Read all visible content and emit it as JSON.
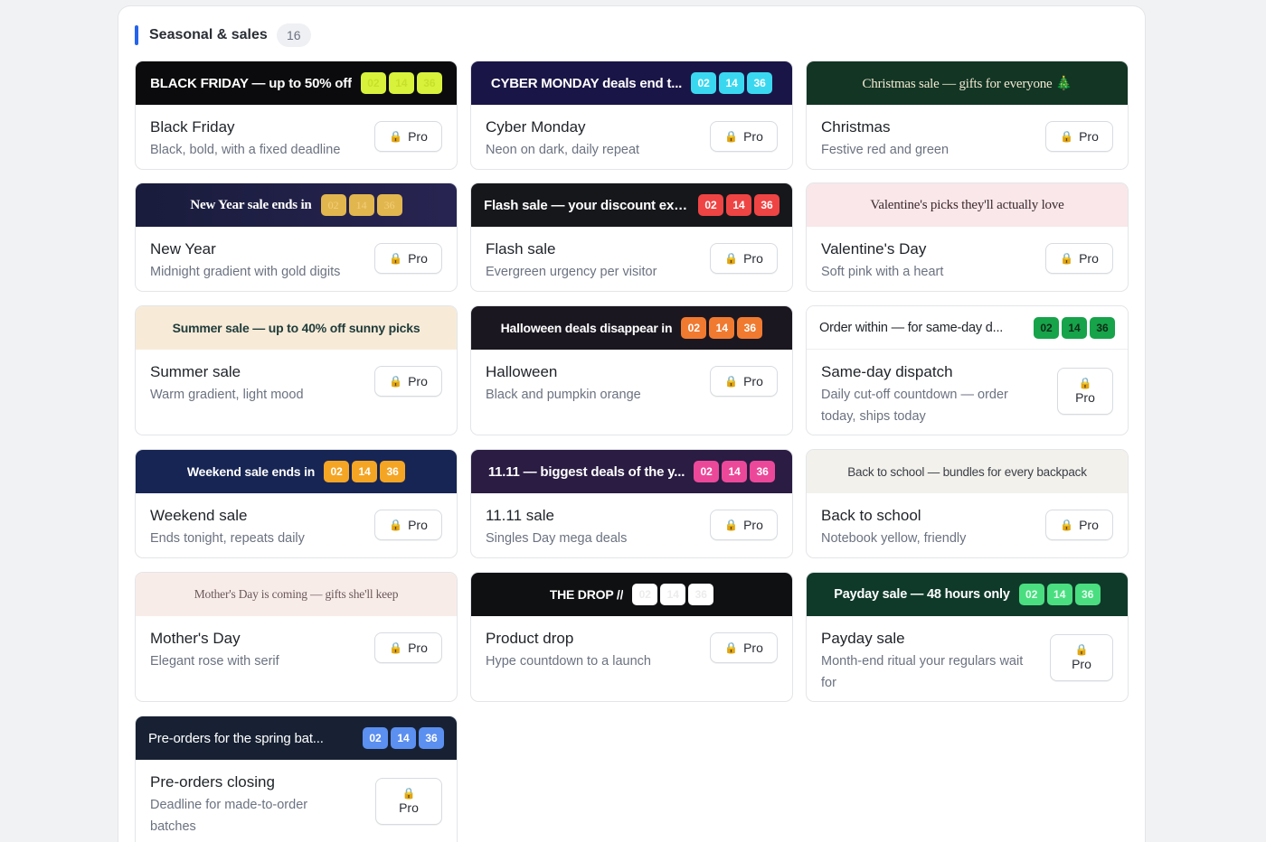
{
  "section": {
    "title": "Seasonal & sales",
    "count": "16"
  },
  "pro_label": "Pro",
  "icons": {
    "lock": "lock-icon"
  },
  "cards": [
    {
      "banner": "BLACK FRIDAY — up to 50% off",
      "title": "Black Friday",
      "desc": "Black, bold, with a fixed deadline",
      "digits": [
        "02",
        "14",
        "36"
      ]
    },
    {
      "banner": "CYBER MONDAY deals end t...",
      "title": "Cyber Monday",
      "desc": "Neon on dark, daily repeat",
      "digits": [
        "02",
        "14",
        "36"
      ]
    },
    {
      "banner": "Christmas sale — gifts for everyone 🎄",
      "title": "Christmas",
      "desc": "Festive red and green",
      "digits": []
    },
    {
      "banner": "New Year sale ends in",
      "title": "New Year",
      "desc": "Midnight gradient with gold digits",
      "digits": [
        "02",
        "14",
        "36"
      ]
    },
    {
      "banner": "Flash sale — your discount exp...",
      "title": "Flash sale",
      "desc": "Evergreen urgency per visitor",
      "digits": [
        "02",
        "14",
        "36"
      ]
    },
    {
      "banner": "Valentine's picks they'll actually love",
      "title": "Valentine's Day",
      "desc": "Soft pink with a heart",
      "digits": []
    },
    {
      "banner": "Summer sale — up to 40% off sunny picks",
      "title": "Summer sale",
      "desc": "Warm gradient, light mood",
      "digits": []
    },
    {
      "banner": "Halloween deals disappear in",
      "title": "Halloween",
      "desc": "Black and pumpkin orange",
      "digits": [
        "02",
        "14",
        "36"
      ]
    },
    {
      "banner": "Order within — for same-day d...",
      "title": "Same-day dispatch",
      "desc": "Daily cut-off countdown — order today, ships today",
      "digits": [
        "02",
        "14",
        "36"
      ]
    },
    {
      "banner": "Weekend sale ends in",
      "title": "Weekend sale",
      "desc": "Ends tonight, repeats daily",
      "digits": [
        "02",
        "14",
        "36"
      ]
    },
    {
      "banner": "11.11 — biggest deals of the y...",
      "title": "11.11 sale",
      "desc": "Singles Day mega deals",
      "digits": [
        "02",
        "14",
        "36"
      ]
    },
    {
      "banner": "Back to school — bundles for every backpack",
      "title": "Back to school",
      "desc": "Notebook yellow, friendly",
      "digits": []
    },
    {
      "banner": "Mother's Day is coming — gifts she'll keep",
      "title": "Mother's Day",
      "desc": "Elegant rose with serif",
      "digits": []
    },
    {
      "banner": "THE DROP //",
      "title": "Product drop",
      "desc": "Hype countdown to a launch",
      "digits": [
        "02",
        "14",
        "36"
      ]
    },
    {
      "banner": "Payday sale — 48 hours only",
      "title": "Payday sale",
      "desc": "Month-end ritual your regulars wait for",
      "digits": [
        "02",
        "14",
        "36"
      ]
    },
    {
      "banner": "Pre-orders for the spring bat...",
      "title": "Pre-orders closing",
      "desc": "Deadline for made-to-order batches",
      "digits": [
        "02",
        "14",
        "36"
      ]
    }
  ],
  "colors": {
    "accent": "#2563eb",
    "black_friday_bg": "#0b0b0d",
    "black_friday_digit": "#d8f23c",
    "cyber_bg": "#1a1547",
    "cyber_digit": "#3ad8f0",
    "christmas_bg": "#123524",
    "new_year_bg": "#1e2248",
    "new_year_digit": "#e2b64f",
    "flash_bg": "#16171b",
    "flash_digit": "#ef4444",
    "valentine_bg": "#f9e7ea",
    "summer_bg": "#f7ebd8",
    "halloween_bg": "#1b1720",
    "halloween_digit": "#f07a30",
    "same_day_bg": "#ffffff",
    "same_day_digit": "#16a34a",
    "weekend_bg": "#172554",
    "weekend_digit": "#f5a524",
    "singles_bg": "#2a1c43",
    "singles_digit": "#ec4899",
    "school_bg": "#f3f1ec",
    "mothers_bg": "#f8ece9",
    "drop_bg": "#0f1012",
    "payday_bg": "#0f3a2a",
    "payday_digit": "#4ade80",
    "preorder_bg": "#172133",
    "preorder_digit": "#5b8ff0"
  }
}
